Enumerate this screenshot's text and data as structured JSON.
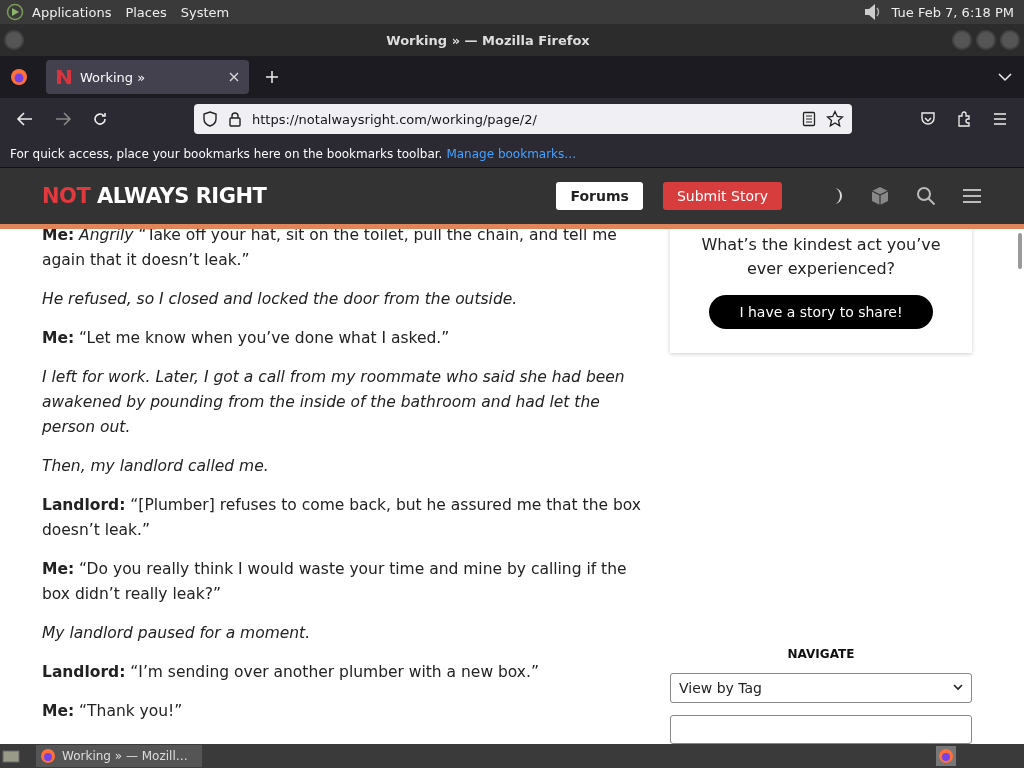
{
  "top_panel": {
    "menus": [
      "Applications",
      "Places",
      "System"
    ],
    "clock": "Tue Feb  7,  6:18 PM"
  },
  "window": {
    "title": "Working » — Mozilla Firefox"
  },
  "tabs": [
    {
      "label": "Working »",
      "selected": true
    }
  ],
  "address_bar": {
    "url": "https://notalwaysright.com/working/page/2/"
  },
  "bookmarks_bar": {
    "text": "For quick access, place your bookmarks here on the bookmarks toolbar.",
    "link": "Manage bookmarks…"
  },
  "site_header": {
    "logo_accent": "NOT",
    "logo_rest": "ALWAYS RIGHT",
    "buttons": [
      {
        "label": "Forums",
        "kind": "light"
      },
      {
        "label": "Submit Story",
        "kind": "accent"
      }
    ]
  },
  "article": [
    {
      "kind": "dialogue",
      "text": "**Me:** *Angrily* “Take off your hat, sit on the toilet, pull the chain, and tell me again that it doesn’t leak.”"
    },
    {
      "kind": "narration",
      "text": "He refused, so I closed and locked the door from the outside."
    },
    {
      "kind": "dialogue",
      "text": "**Me:** “Let me know when you’ve done what I asked.”"
    },
    {
      "kind": "narration",
      "text": "I left for work. Later, I got a call from my roommate who said she had been awakened by pounding from the inside of the bathroom and had let the person out."
    },
    {
      "kind": "narration",
      "text": "Then, my landlord called me."
    },
    {
      "kind": "dialogue",
      "text": "**Landlord:** “[Plumber] refuses to come back, but he assured me that the box doesn’t leak.”"
    },
    {
      "kind": "dialogue",
      "text": "**Me:** “Do you really think I would waste your time and mine by calling if the box didn’t really leak?”"
    },
    {
      "kind": "narration",
      "text": "My landlord paused for a moment."
    },
    {
      "kind": "dialogue",
      "text": "**Landlord:** “I’m sending over another plumber with a new box.”"
    },
    {
      "kind": "dialogue",
      "text": "**Me:** “Thank you!”"
    }
  ],
  "sidebar": {
    "prompt": "What’s the kindest act you’ve ever experienced?",
    "share_button": "I have a story to share!",
    "navigate_heading": "NAVIGATE",
    "tag_select": "View by Tag"
  },
  "taskbar": {
    "windows": [
      {
        "label": "Working » — Mozill…",
        "selected": true
      }
    ]
  }
}
